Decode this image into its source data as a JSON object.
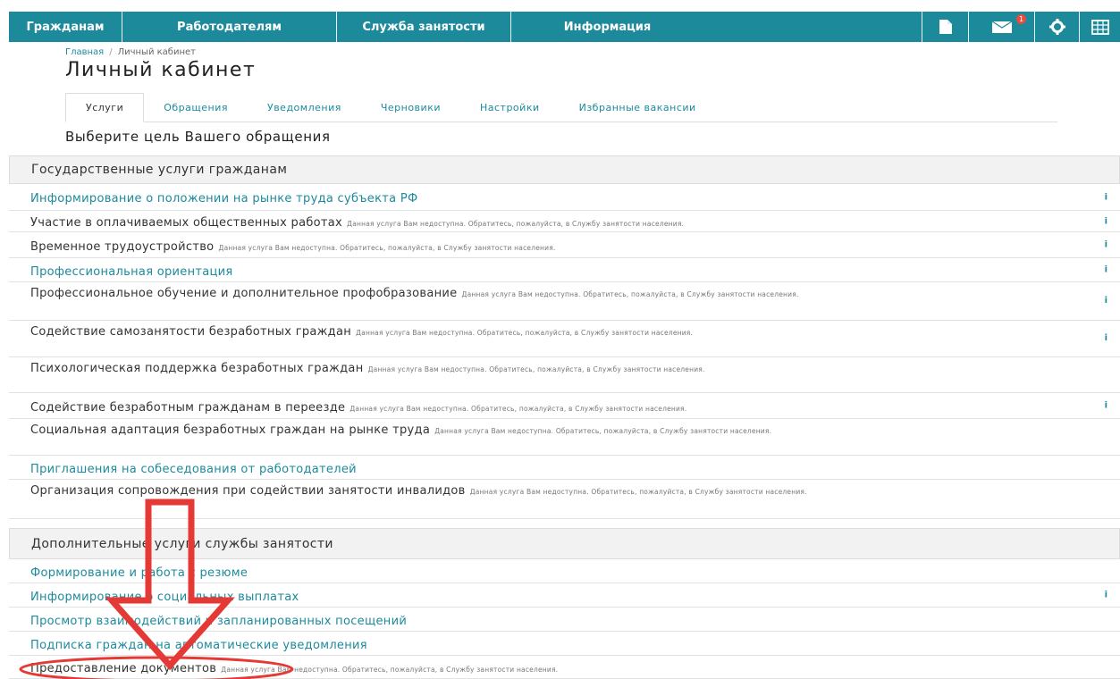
{
  "nav": {
    "items": [
      "Гражданам",
      "Работодателям",
      "Служба занятости",
      "Информация"
    ],
    "icons": [
      "document-icon",
      "mail-icon",
      "gear-icon",
      "calendar-icon"
    ],
    "mail_badge": "1"
  },
  "breadcrumb": {
    "home": "Главная",
    "separator": "/",
    "current": "Личный кабинет"
  },
  "page_title": "Личный кабинет",
  "tabs": [
    "Услуги",
    "Обращения",
    "Уведомления",
    "Черновики",
    "Настройки",
    "Избранные вакансии"
  ],
  "subtitle": "Выберите цель Вашего обращения",
  "section1": {
    "title": "Государственные услуги гражданам",
    "items": [
      {
        "label": "Информирование о положении на рынке труда субъекта РФ",
        "note": "",
        "info": true,
        "link": true
      },
      {
        "label": "Участие в оплачиваемых общественных работах",
        "note": "Данная услуга Вам недоступна. Обратитесь, пожалуйста, в Службу занятости населения.",
        "info": true,
        "link": false
      },
      {
        "label": "Временное трудоустройство",
        "note": "Данная услуга Вам недоступна. Обратитесь, пожалуйста, в Службу занятости населения.",
        "info": true,
        "link": false
      },
      {
        "label": "Профессиональная ориентация",
        "note": "",
        "info": true,
        "link": true
      },
      {
        "label": "Профессиональное обучение и дополнительное профобразование",
        "note": "Данная услуга Вам недоступна. Обратитесь, пожалуйста, в Службу занятости населения.",
        "info": true,
        "link": false
      },
      {
        "label": "Содействие самозанятости безработных граждан",
        "note": "Данная услуга Вам недоступна. Обратитесь, пожалуйста, в Службу занятости населения.",
        "info": true,
        "link": false
      },
      {
        "label": "Психологическая поддержка безработных граждан",
        "note": "Данная услуга Вам недоступна. Обратитесь, пожалуйста, в Службу занятости населения.",
        "info": false,
        "link": false
      },
      {
        "label": "Содействие безработным гражданам в переезде",
        "note": "Данная услуга Вам недоступна. Обратитесь, пожалуйста, в Службу занятости населения.",
        "info": true,
        "link": false
      },
      {
        "label": "Социальная адаптация безработных граждан на рынке труда",
        "note": "Данная услуга Вам недоступна. Обратитесь, пожалуйста, в Службу занятости населения.",
        "info": false,
        "link": false
      },
      {
        "label": "Приглашения на собеседования от работодателей",
        "note": "",
        "info": false,
        "link": true
      },
      {
        "label": "Организация сопровождения при содействии занятости инвалидов",
        "note": "Данная услуга Вам недоступна. Обратитесь, пожалуйста, в Службу занятости населения.",
        "info": false,
        "link": false
      }
    ]
  },
  "section2": {
    "title": "Дополнительные услуги службы занятости",
    "items": [
      {
        "label": "Формирование и работа с резюме",
        "note": "",
        "info": false,
        "link": true
      },
      {
        "label": "Информирование о социальных выплатах",
        "note": "",
        "info": true,
        "link": true
      },
      {
        "label": "Просмотр взаимодействий и запланированных посещений",
        "note": "",
        "info": false,
        "link": true
      },
      {
        "label": "Подписка граждан на автоматические уведомления",
        "note": "",
        "info": false,
        "link": true
      },
      {
        "label": "Предоставление документов",
        "note": "Данная услуга Вам недоступна. Обратитесь, пожалуйста, в Службу занятости населения.",
        "info": false,
        "link": false
      }
    ]
  },
  "info_glyph": "i",
  "colors": {
    "nav": "#1d8a9c",
    "link": "#1d8a9c",
    "annotation": "#e53935"
  }
}
